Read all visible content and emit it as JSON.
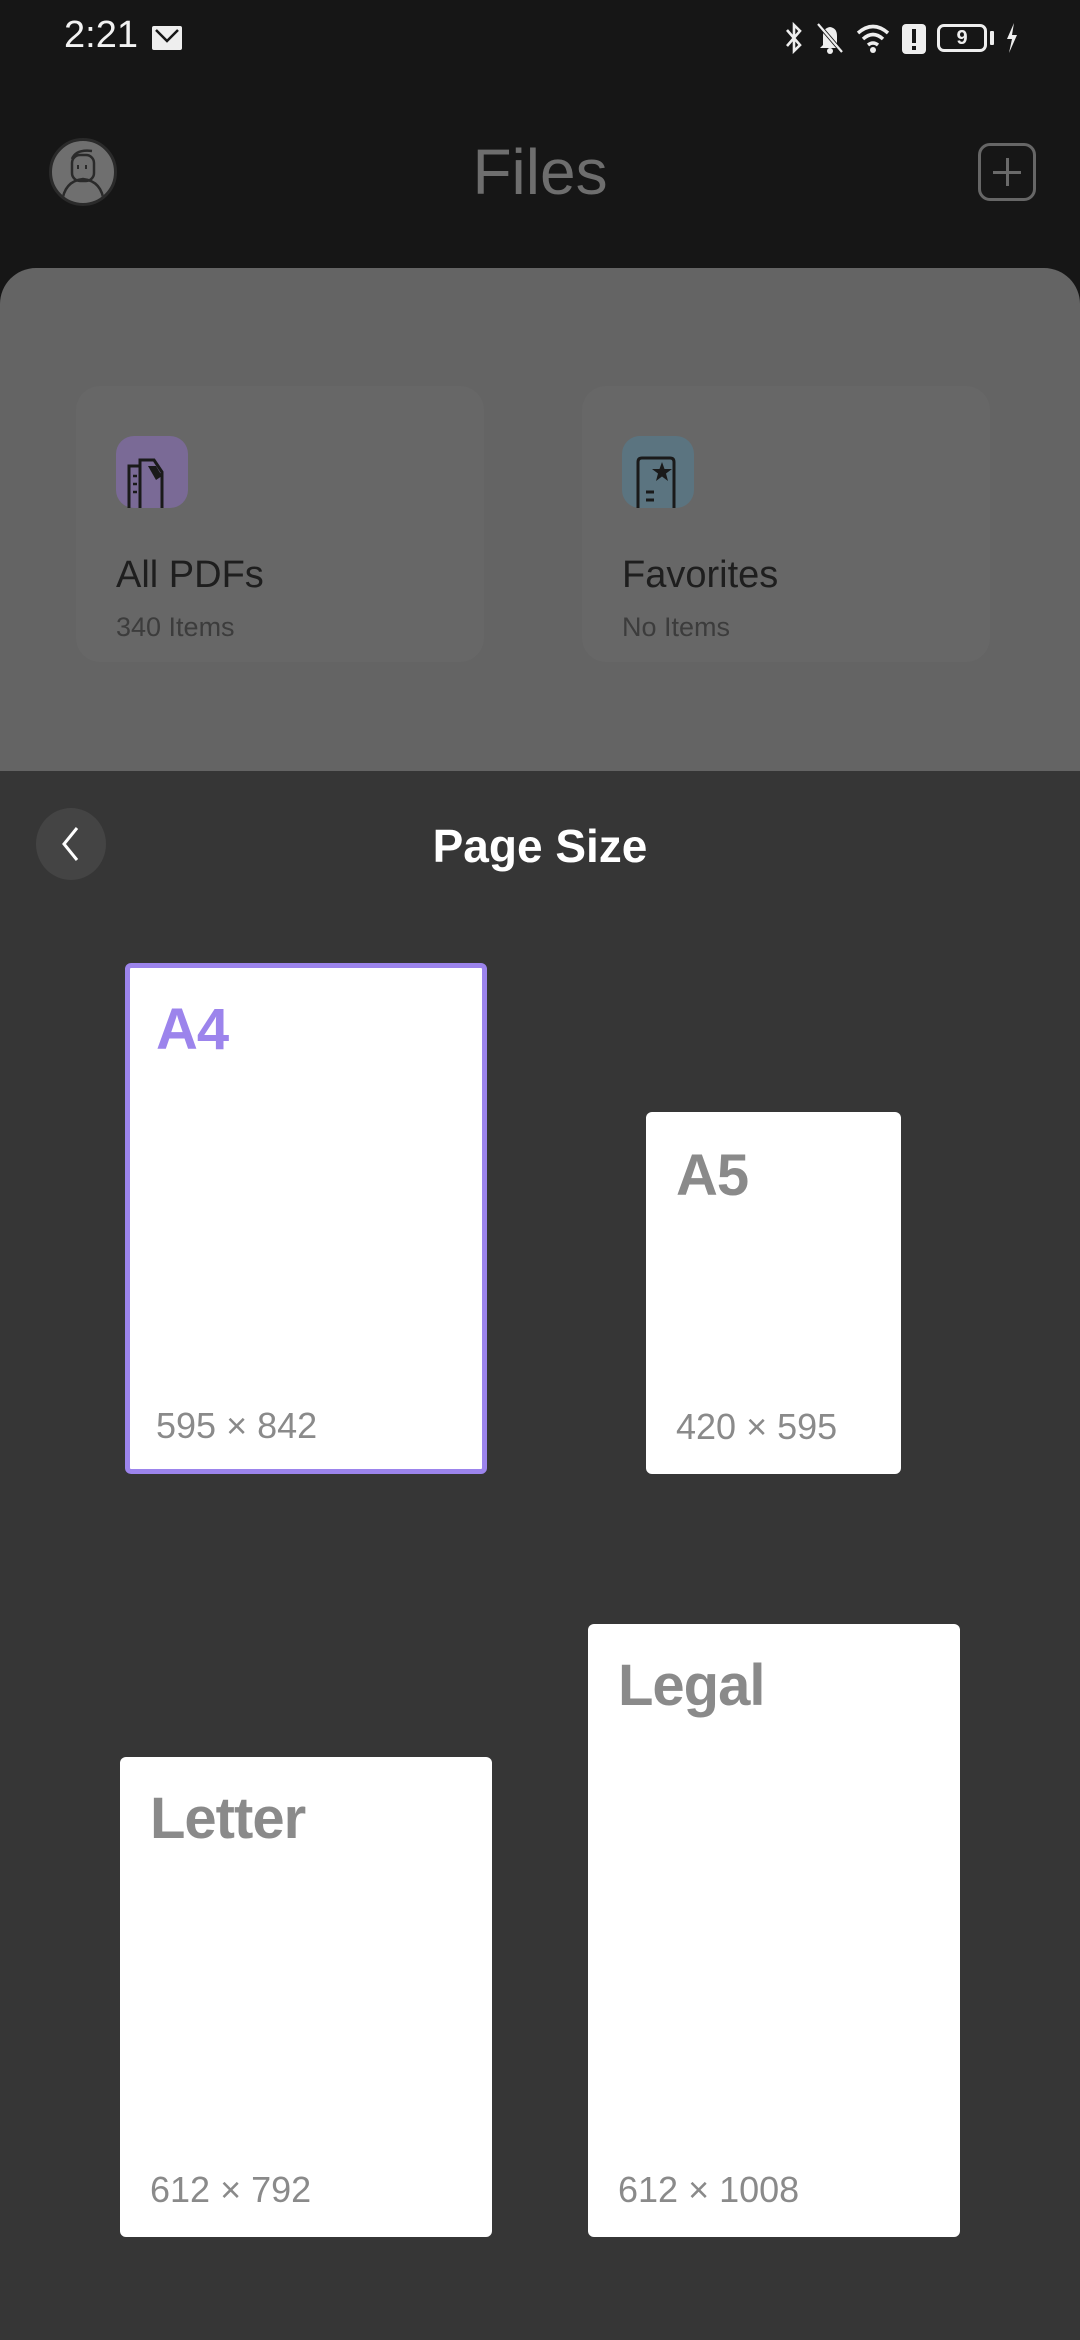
{
  "status_bar": {
    "time": "2:21",
    "battery_level": "9",
    "icons": [
      "mail-icon",
      "bluetooth-icon",
      "bell-muted-icon",
      "wifi-icon",
      "alert-icon",
      "battery-icon",
      "charging-icon"
    ]
  },
  "app_header": {
    "title": "Files",
    "avatar_icon": "user-avatar-icon",
    "add_icon": "plus-square-icon"
  },
  "folders": [
    {
      "name": "All PDFs",
      "count": "340 Items",
      "icon": "pdf-stack-icon",
      "color": "#7a6a96"
    },
    {
      "name": "Favorites",
      "count": "No Items",
      "icon": "star-document-icon",
      "color": "#5b7480"
    }
  ],
  "page_size_sheet": {
    "title": "Page Size",
    "back_icon": "chevron-left-icon",
    "accent_color": "#9c84ec",
    "selected": "A4",
    "sizes": [
      {
        "name": "A4",
        "dims": "595 × 842",
        "selected": true
      },
      {
        "name": "A5",
        "dims": "420 × 595",
        "selected": false
      },
      {
        "name": "Letter",
        "dims": "612 × 792",
        "selected": false
      },
      {
        "name": "Legal",
        "dims": "612 × 1008",
        "selected": false
      }
    ]
  }
}
